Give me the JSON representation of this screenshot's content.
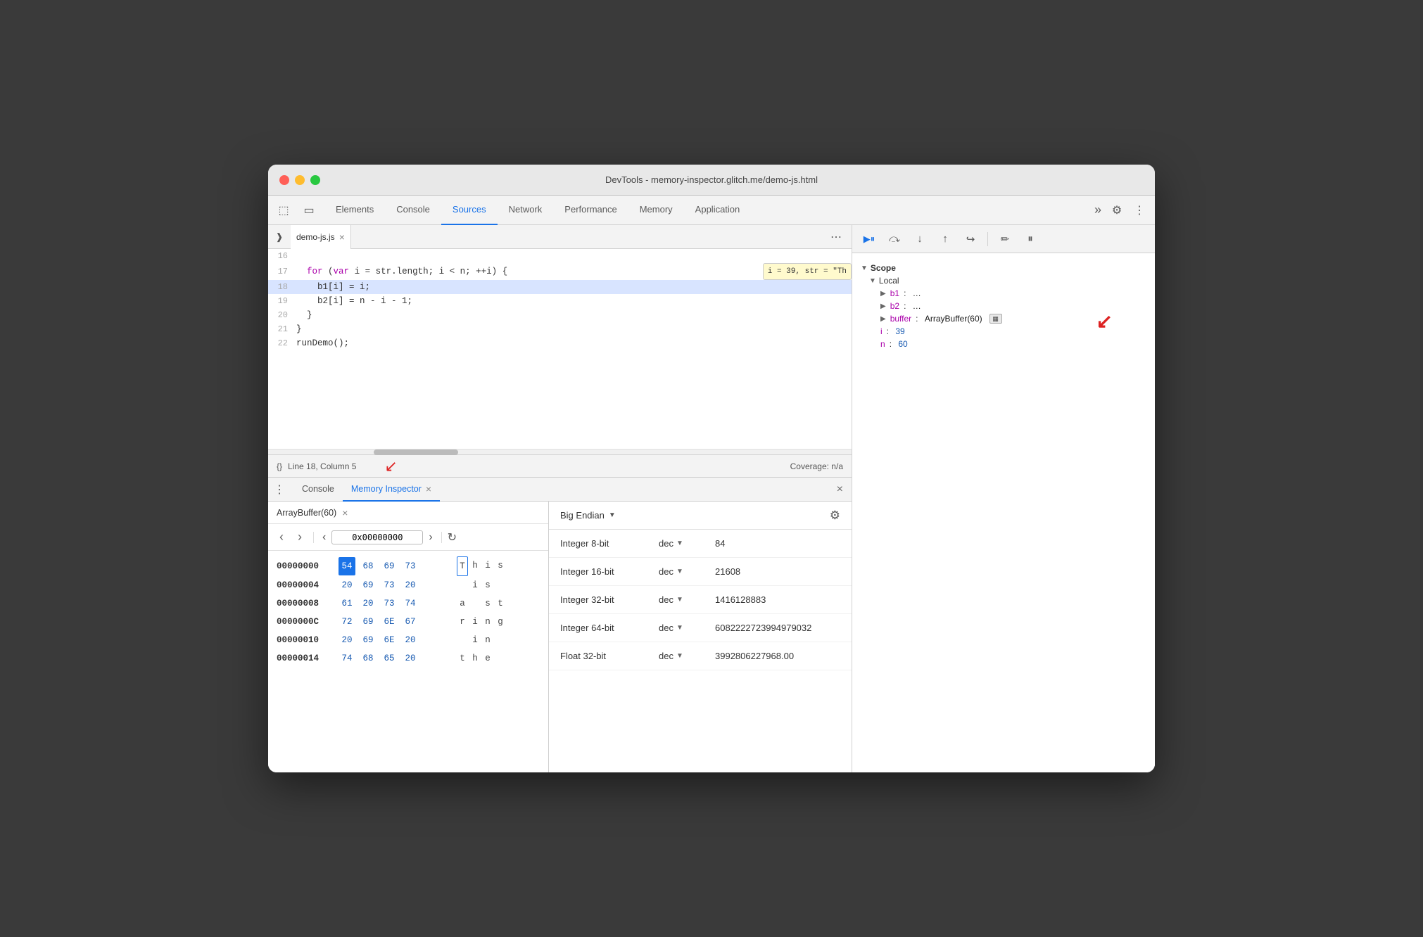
{
  "window": {
    "title": "DevTools - memory-inspector.glitch.me/demo-js.html"
  },
  "traffic_lights": {
    "red": "close",
    "yellow": "minimize",
    "green": "maximize"
  },
  "top_tabs": {
    "items": [
      {
        "label": "Elements",
        "active": false
      },
      {
        "label": "Console",
        "active": false
      },
      {
        "label": "Sources",
        "active": true
      },
      {
        "label": "Network",
        "active": false
      },
      {
        "label": "Performance",
        "active": false
      },
      {
        "label": "Memory",
        "active": false
      },
      {
        "label": "Application",
        "active": false
      }
    ],
    "more_icon": "»"
  },
  "file_tab": {
    "name": "demo-js.js",
    "close": "×"
  },
  "code": {
    "lines": [
      {
        "num": "16",
        "content": "",
        "highlighted": false
      },
      {
        "num": "17",
        "content": "  for (var i = str.length; i < n; ++i) {",
        "highlighted": false,
        "tooltip": "i = 39, str = \"Th"
      },
      {
        "num": "18",
        "content": "    b1[i] = i;",
        "highlighted": true
      },
      {
        "num": "19",
        "content": "    b2[i] = n - i - 1;",
        "highlighted": false
      },
      {
        "num": "20",
        "content": "  }",
        "highlighted": false
      },
      {
        "num": "21",
        "content": "}",
        "highlighted": false
      },
      {
        "num": "22",
        "content": "runDemo();",
        "highlighted": false
      }
    ]
  },
  "code_status": {
    "position": "Line 18, Column 5",
    "format": "{}",
    "coverage": "Coverage: n/a"
  },
  "debugger_buttons": [
    {
      "icon": "▶",
      "label": "resume",
      "active": true
    },
    {
      "icon": "⏩",
      "label": "step-over"
    },
    {
      "icon": "⬇",
      "label": "step-into"
    },
    {
      "icon": "⬆",
      "label": "step-out"
    },
    {
      "icon": "↪",
      "label": "step"
    },
    {
      "separator": true
    },
    {
      "icon": "✏",
      "label": "deactivate-breakpoints"
    },
    {
      "icon": "⏸",
      "label": "pause-on-exceptions"
    }
  ],
  "scope": {
    "title": "Scope",
    "local": {
      "label": "Local",
      "items": [
        {
          "key": "b1",
          "val": "…",
          "has_children": true
        },
        {
          "key": "b2",
          "val": "…",
          "has_children": true
        },
        {
          "key": "buffer",
          "val": "ArrayBuffer(60)",
          "has_children": true,
          "has_memory_icon": true
        },
        {
          "key": "i",
          "val": "39"
        },
        {
          "key": "n",
          "val": "60"
        }
      ]
    }
  },
  "bottom_tabs": {
    "items": [
      {
        "label": "Console",
        "active": false
      },
      {
        "label": "Memory Inspector",
        "active": true
      }
    ],
    "close_label": "×"
  },
  "memory_tab": {
    "buffer_label": "ArrayBuffer(60)",
    "close": "×"
  },
  "memory_nav": {
    "back": "‹",
    "forward": "›",
    "address": "0x00000000",
    "refresh": "↻"
  },
  "endian": {
    "label": "Big Endian",
    "caret": "▼"
  },
  "hex_rows": [
    {
      "addr": "00000000",
      "bytes": [
        "54",
        "68",
        "69",
        "73"
      ],
      "chars": [
        "T",
        "h",
        "i",
        "s"
      ],
      "byte_selected": [
        0
      ],
      "char_outlined": [
        0
      ]
    },
    {
      "addr": "00000004",
      "bytes": [
        "20",
        "69",
        "73",
        "20"
      ],
      "chars": [
        "",
        "i",
        "s",
        ""
      ],
      "byte_selected": [],
      "char_outlined": []
    },
    {
      "addr": "00000008",
      "bytes": [
        "61",
        "20",
        "73",
        "74"
      ],
      "chars": [
        "a",
        "",
        "s",
        "t"
      ],
      "byte_selected": [],
      "char_outlined": []
    },
    {
      "addr": "0000000C",
      "bytes": [
        "72",
        "69",
        "6E",
        "67"
      ],
      "chars": [
        "r",
        "i",
        "n",
        "g"
      ],
      "byte_selected": [],
      "char_outlined": []
    },
    {
      "addr": "00000010",
      "bytes": [
        "20",
        "69",
        "6E",
        "20"
      ],
      "chars": [
        "",
        "i",
        "n",
        ""
      ],
      "byte_selected": [],
      "char_outlined": []
    },
    {
      "addr": "00000014",
      "bytes": [
        "74",
        "68",
        "65",
        "20"
      ],
      "chars": [
        "t",
        "h",
        "e",
        ""
      ],
      "byte_selected": [],
      "char_outlined": []
    }
  ],
  "data_types": [
    {
      "label": "Integer 8-bit",
      "format": "dec",
      "value": "84"
    },
    {
      "label": "Integer 16-bit",
      "format": "dec",
      "value": "21608"
    },
    {
      "label": "Integer 32-bit",
      "format": "dec",
      "value": "1416128883"
    },
    {
      "label": "Integer 64-bit",
      "format": "dec",
      "value": "6082222723994979032"
    },
    {
      "label": "Float 32-bit",
      "format": "dec",
      "value": "3992806227968.00"
    }
  ]
}
